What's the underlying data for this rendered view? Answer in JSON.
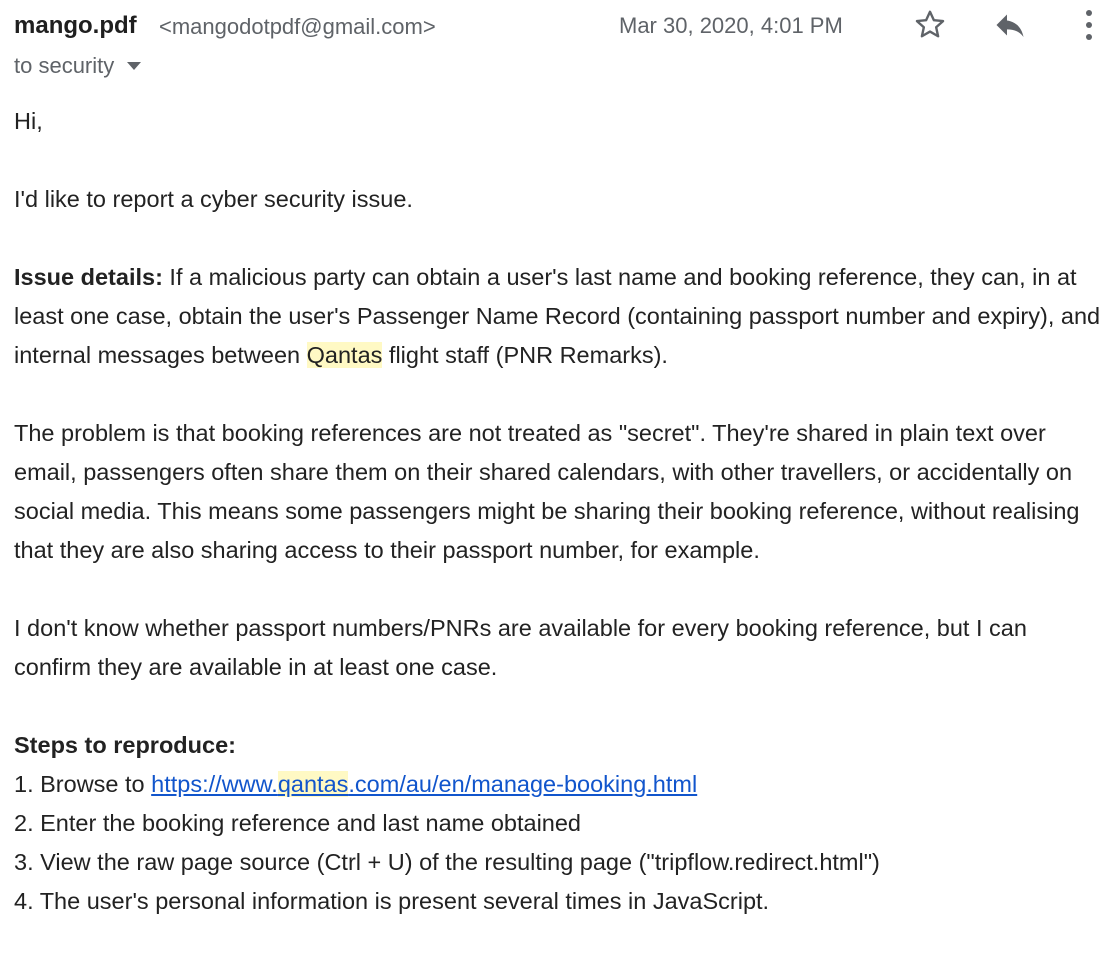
{
  "header": {
    "sender_name": "mango.pdf",
    "sender_email": "<mangodotpdf@gmail.com>",
    "date": "Mar 30, 2020, 4:01 PM",
    "icons": [
      "star-icon",
      "reply-icon",
      "more-vert-icon"
    ]
  },
  "recipient": {
    "label": "to security",
    "icon": "caret-down-icon"
  },
  "body": {
    "greeting": "Hi,",
    "intro": "I'd like to report a cyber security issue.",
    "issue": {
      "label": "Issue details:",
      "text_1": " If a malicious party can obtain a user's last name and booking reference, they can, in at least one case, obtain the user's Passenger Name Record (containing passport number and expiry), and internal messages between ",
      "highlight": "Qantas",
      "text_2": " flight staff (PNR Remarks)."
    },
    "problem": "The problem is that booking references are not treated as \"secret\". They're shared in plain text over email, passengers often share them on their shared calendars, with other travellers, or accidentally on social media. This means some passengers might be sharing their booking reference, without realising that they are also sharing access to their passport number, for example.",
    "uncertainty": "I don't know whether passport numbers/PNRs are available for every booking reference, but I can confirm they are available in at least one case.",
    "steps": {
      "label": "Steps to reproduce:",
      "step1_prefix": "1. Browse to ",
      "step1_link_before": "https://www.",
      "step1_link_highlight": "qantas",
      "step1_link_after": ".com/au/en/manage-booking.html",
      "step2": "2. Enter the booking reference and last name obtained",
      "step3": "3. View the raw page source (Ctrl + U) of the resulting page (\"tripflow.redirect.html\")",
      "step4": "4. The user's personal information is present several times in JavaScript."
    }
  },
  "colors": {
    "text": "#222222",
    "muted": "#5f6368",
    "link": "#1155cc",
    "highlight": "#fff9c4"
  }
}
